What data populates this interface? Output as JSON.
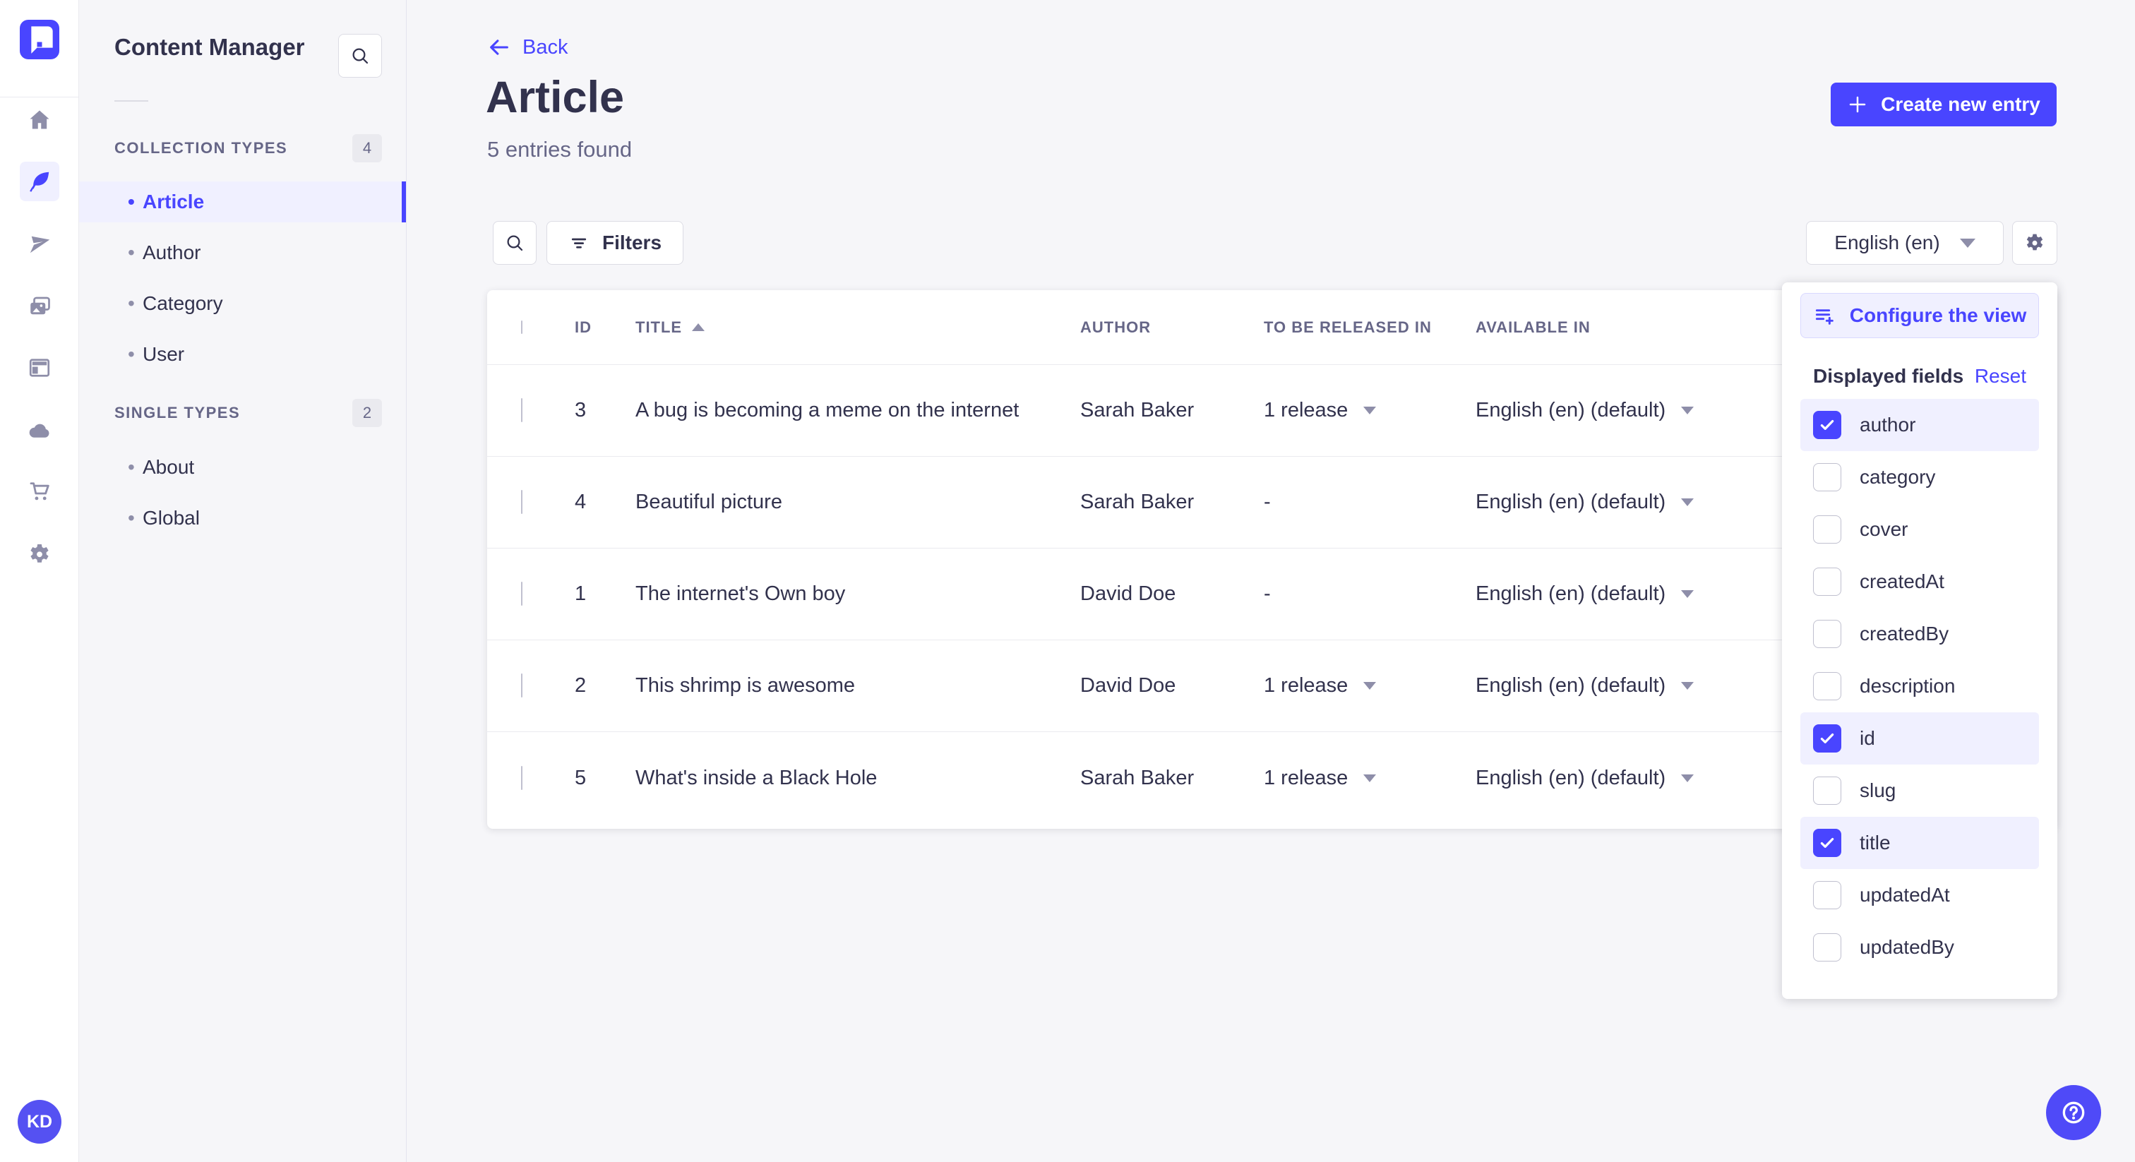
{
  "colors": {
    "primary": "#4945ff",
    "primary_light_bg": "#f0f0ff",
    "text": "#32324d",
    "muted": "#666687",
    "icon_gray": "#8e8ea9",
    "border": "#dcdce4",
    "page_bg": "#f6f6f9"
  },
  "icons": {
    "rail": [
      "strapi-logo",
      "home-icon",
      "content-manager-icon",
      "send-icon",
      "media-library-icon",
      "content-type-builder-icon",
      "cloud-icon",
      "marketplace-cart-icon",
      "settings-gear-icon"
    ],
    "other": [
      "search-icon",
      "filter-icon",
      "chevron-down-icon",
      "sort-asc-icon",
      "plus-icon",
      "arrow-left-icon",
      "configure-list-icon",
      "check-icon",
      "question-icon"
    ]
  },
  "sidebar": {
    "title": "Content Manager",
    "collection_types": {
      "label": "COLLECTION TYPES",
      "count": "4",
      "items": [
        {
          "label": "Article",
          "active": true
        },
        {
          "label": "Author",
          "active": false
        },
        {
          "label": "Category",
          "active": false
        },
        {
          "label": "User",
          "active": false
        }
      ]
    },
    "single_types": {
      "label": "SINGLE TYPES",
      "count": "2",
      "items": [
        {
          "label": "About",
          "active": false
        },
        {
          "label": "Global",
          "active": false
        }
      ]
    }
  },
  "user": {
    "initials": "KD"
  },
  "header": {
    "back_label": "Back",
    "title": "Article",
    "subtitle": "5 entries found",
    "create_button_label": "Create new entry"
  },
  "toolbar": {
    "filters_label": "Filters",
    "locale_selected": "English (en)"
  },
  "table": {
    "columns": [
      "ID",
      "TITLE",
      "AUTHOR",
      "TO BE RELEASED IN",
      "AVAILABLE IN"
    ],
    "sorted_column": "TITLE",
    "sort_direction": "asc",
    "rows": [
      {
        "id": "3",
        "title": "A bug is becoming a meme on the internet",
        "author": "Sarah Baker",
        "release": "1 release",
        "release_menu": true,
        "available": "English (en) (default)"
      },
      {
        "id": "4",
        "title": "Beautiful picture",
        "author": "Sarah Baker",
        "release": "-",
        "release_menu": false,
        "available": "English (en) (default)"
      },
      {
        "id": "1",
        "title": "The internet's Own boy",
        "author": "David Doe",
        "release": "-",
        "release_menu": false,
        "available": "English (en) (default)"
      },
      {
        "id": "2",
        "title": "This shrimp is awesome",
        "author": "David Doe",
        "release": "1 release",
        "release_menu": true,
        "available": "English (en) (default)"
      },
      {
        "id": "5",
        "title": "What's inside a Black Hole",
        "author": "Sarah Baker",
        "release": "1 release",
        "release_menu": true,
        "available": "English (en) (default)"
      }
    ]
  },
  "popover": {
    "configure_button_label": "Configure the view",
    "displayed_fields_label": "Displayed fields",
    "reset_label": "Reset",
    "fields": [
      {
        "label": "author",
        "checked": true
      },
      {
        "label": "category",
        "checked": false
      },
      {
        "label": "cover",
        "checked": false
      },
      {
        "label": "createdAt",
        "checked": false
      },
      {
        "label": "createdBy",
        "checked": false
      },
      {
        "label": "description",
        "checked": false
      },
      {
        "label": "id",
        "checked": true
      },
      {
        "label": "slug",
        "checked": false
      },
      {
        "label": "title",
        "checked": true
      },
      {
        "label": "updatedAt",
        "checked": false
      },
      {
        "label": "updatedBy",
        "checked": false
      }
    ]
  }
}
